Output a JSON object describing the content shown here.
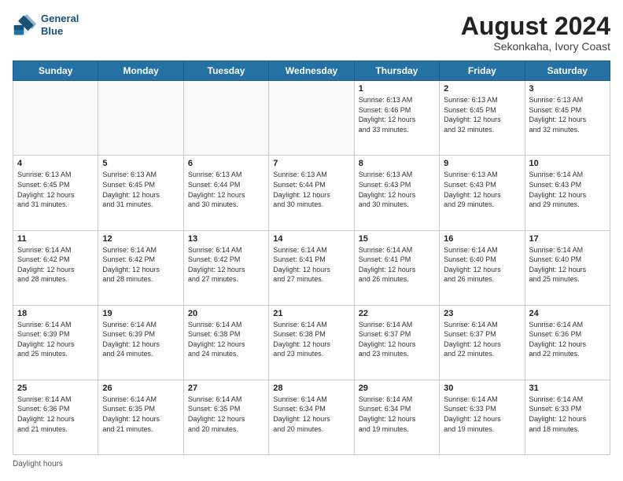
{
  "logo": {
    "line1": "General",
    "line2": "Blue"
  },
  "title": "August 2024",
  "location": "Sekonkaha, Ivory Coast",
  "days_of_week": [
    "Sunday",
    "Monday",
    "Tuesday",
    "Wednesday",
    "Thursday",
    "Friday",
    "Saturday"
  ],
  "footer": "Daylight hours",
  "weeks": [
    [
      {
        "day": "",
        "info": ""
      },
      {
        "day": "",
        "info": ""
      },
      {
        "day": "",
        "info": ""
      },
      {
        "day": "",
        "info": ""
      },
      {
        "day": "1",
        "info": "Sunrise: 6:13 AM\nSunset: 6:46 PM\nDaylight: 12 hours\nand 33 minutes."
      },
      {
        "day": "2",
        "info": "Sunrise: 6:13 AM\nSunset: 6:45 PM\nDaylight: 12 hours\nand 32 minutes."
      },
      {
        "day": "3",
        "info": "Sunrise: 6:13 AM\nSunset: 6:45 PM\nDaylight: 12 hours\nand 32 minutes."
      }
    ],
    [
      {
        "day": "4",
        "info": "Sunrise: 6:13 AM\nSunset: 6:45 PM\nDaylight: 12 hours\nand 31 minutes."
      },
      {
        "day": "5",
        "info": "Sunrise: 6:13 AM\nSunset: 6:45 PM\nDaylight: 12 hours\nand 31 minutes."
      },
      {
        "day": "6",
        "info": "Sunrise: 6:13 AM\nSunset: 6:44 PM\nDaylight: 12 hours\nand 30 minutes."
      },
      {
        "day": "7",
        "info": "Sunrise: 6:13 AM\nSunset: 6:44 PM\nDaylight: 12 hours\nand 30 minutes."
      },
      {
        "day": "8",
        "info": "Sunrise: 6:13 AM\nSunset: 6:43 PM\nDaylight: 12 hours\nand 30 minutes."
      },
      {
        "day": "9",
        "info": "Sunrise: 6:13 AM\nSunset: 6:43 PM\nDaylight: 12 hours\nand 29 minutes."
      },
      {
        "day": "10",
        "info": "Sunrise: 6:14 AM\nSunset: 6:43 PM\nDaylight: 12 hours\nand 29 minutes."
      }
    ],
    [
      {
        "day": "11",
        "info": "Sunrise: 6:14 AM\nSunset: 6:42 PM\nDaylight: 12 hours\nand 28 minutes."
      },
      {
        "day": "12",
        "info": "Sunrise: 6:14 AM\nSunset: 6:42 PM\nDaylight: 12 hours\nand 28 minutes."
      },
      {
        "day": "13",
        "info": "Sunrise: 6:14 AM\nSunset: 6:42 PM\nDaylight: 12 hours\nand 27 minutes."
      },
      {
        "day": "14",
        "info": "Sunrise: 6:14 AM\nSunset: 6:41 PM\nDaylight: 12 hours\nand 27 minutes."
      },
      {
        "day": "15",
        "info": "Sunrise: 6:14 AM\nSunset: 6:41 PM\nDaylight: 12 hours\nand 26 minutes."
      },
      {
        "day": "16",
        "info": "Sunrise: 6:14 AM\nSunset: 6:40 PM\nDaylight: 12 hours\nand 26 minutes."
      },
      {
        "day": "17",
        "info": "Sunrise: 6:14 AM\nSunset: 6:40 PM\nDaylight: 12 hours\nand 25 minutes."
      }
    ],
    [
      {
        "day": "18",
        "info": "Sunrise: 6:14 AM\nSunset: 6:39 PM\nDaylight: 12 hours\nand 25 minutes."
      },
      {
        "day": "19",
        "info": "Sunrise: 6:14 AM\nSunset: 6:39 PM\nDaylight: 12 hours\nand 24 minutes."
      },
      {
        "day": "20",
        "info": "Sunrise: 6:14 AM\nSunset: 6:38 PM\nDaylight: 12 hours\nand 24 minutes."
      },
      {
        "day": "21",
        "info": "Sunrise: 6:14 AM\nSunset: 6:38 PM\nDaylight: 12 hours\nand 23 minutes."
      },
      {
        "day": "22",
        "info": "Sunrise: 6:14 AM\nSunset: 6:37 PM\nDaylight: 12 hours\nand 23 minutes."
      },
      {
        "day": "23",
        "info": "Sunrise: 6:14 AM\nSunset: 6:37 PM\nDaylight: 12 hours\nand 22 minutes."
      },
      {
        "day": "24",
        "info": "Sunrise: 6:14 AM\nSunset: 6:36 PM\nDaylight: 12 hours\nand 22 minutes."
      }
    ],
    [
      {
        "day": "25",
        "info": "Sunrise: 6:14 AM\nSunset: 6:36 PM\nDaylight: 12 hours\nand 21 minutes."
      },
      {
        "day": "26",
        "info": "Sunrise: 6:14 AM\nSunset: 6:35 PM\nDaylight: 12 hours\nand 21 minutes."
      },
      {
        "day": "27",
        "info": "Sunrise: 6:14 AM\nSunset: 6:35 PM\nDaylight: 12 hours\nand 20 minutes."
      },
      {
        "day": "28",
        "info": "Sunrise: 6:14 AM\nSunset: 6:34 PM\nDaylight: 12 hours\nand 20 minutes."
      },
      {
        "day": "29",
        "info": "Sunrise: 6:14 AM\nSunset: 6:34 PM\nDaylight: 12 hours\nand 19 minutes."
      },
      {
        "day": "30",
        "info": "Sunrise: 6:14 AM\nSunset: 6:33 PM\nDaylight: 12 hours\nand 19 minutes."
      },
      {
        "day": "31",
        "info": "Sunrise: 6:14 AM\nSunset: 6:33 PM\nDaylight: 12 hours\nand 18 minutes."
      }
    ]
  ]
}
